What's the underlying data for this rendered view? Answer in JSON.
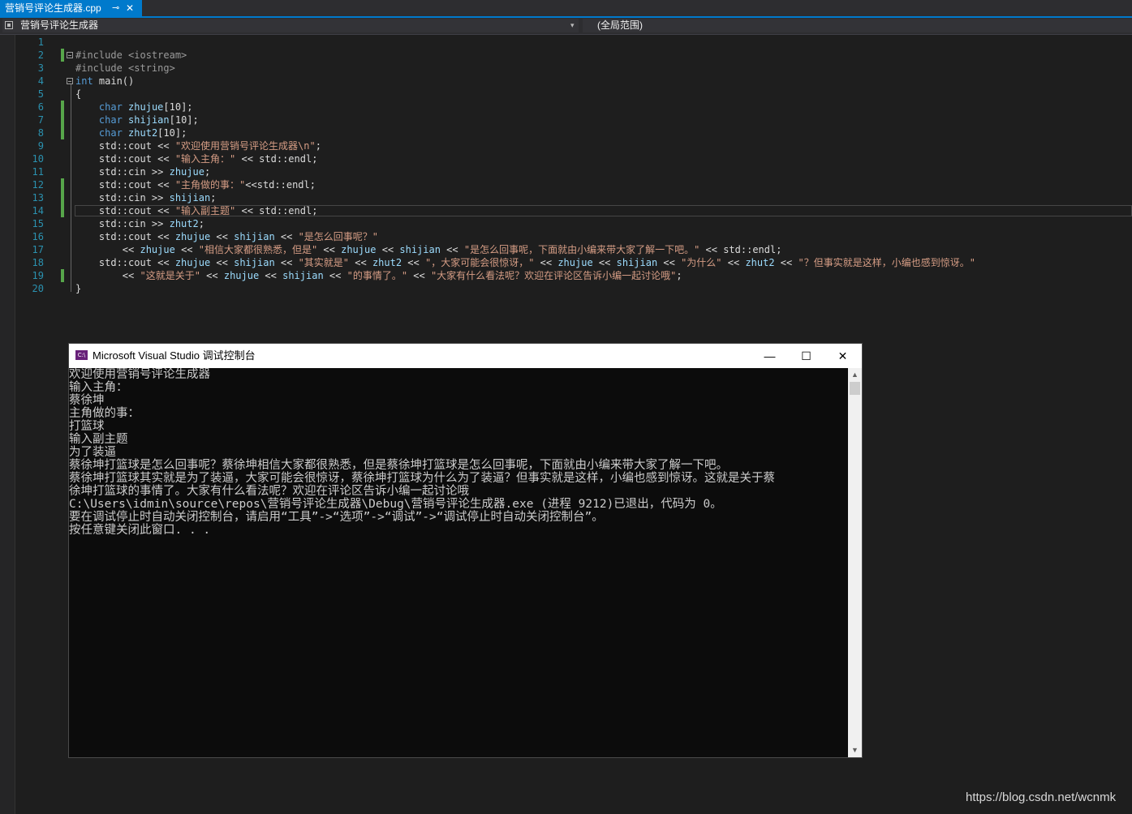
{
  "tab": {
    "title": "营销号评论生成器.cpp",
    "pin": "⊸",
    "close": "✕"
  },
  "nav": {
    "project": "营销号评论生成器",
    "scope": "(全局范围)"
  },
  "editor": {
    "line_numbers": [
      "1",
      "2",
      "3",
      "4",
      "5",
      "6",
      "7",
      "8",
      "9",
      "10",
      "11",
      "12",
      "13",
      "14",
      "15",
      "16",
      "17",
      "18",
      "19",
      "20"
    ],
    "code": [
      "",
      "#include <iostream>",
      "#include <string>",
      "int main()",
      "{",
      "    char zhujue[10];",
      "    char shijian[10];",
      "    char zhut2[10];",
      "    std::cout << \"欢迎使用营销号评论生成器\\n\";",
      "    std::cout << \"输入主角：\" << std::endl;",
      "    std::cin >> zhujue;",
      "    std::cout << \"主角做的事：\"<<std::endl;",
      "    std::cin >> shijian;",
      "    std::cout << \"输入副主题\" << std::endl;",
      "    std::cin >> zhut2;",
      "    std::cout << zhujue << shijian << \"是怎么回事呢？\"",
      "        << zhujue << \"相信大家都很熟悉，但是\" << zhujue << shijian << \"是怎么回事呢，下面就由小编来带大家了解一下吧。\" << std::endl;",
      "    std::cout << zhujue << shijian << \"其实就是\" << zhut2 << \"，大家可能会很惊讶，\" << zhujue << shijian << \"为什么\" << zhut2 << \"？但事实就是这样，小编也感到惊讶。\"",
      "        << \"这就是关于\" << zhujue << shijian << \"的事情了。\" << \"大家有什么看法呢？欢迎在评论区告诉小编一起讨论哦\";",
      "}"
    ]
  },
  "console": {
    "icon": "C:\\",
    "title": "Microsoft Visual Studio 调试控制台",
    "minimize": "—",
    "maximize": "☐",
    "close": "✕",
    "lines": [
      "欢迎使用营销号评论生成器",
      "输入主角：",
      "蔡徐坤",
      "主角做的事：",
      "打篮球",
      "输入副主题",
      "为了装逼",
      "蔡徐坤打篮球是怎么回事呢？蔡徐坤相信大家都很熟悉，但是蔡徐坤打篮球是怎么回事呢，下面就由小编来带大家了解一下吧。",
      "蔡徐坤打篮球其实就是为了装逼，大家可能会很惊讶，蔡徐坤打篮球为什么为了装逼？但事实就是这样，小编也感到惊讶。这就是关于蔡",
      "徐坤打篮球的事情了。大家有什么看法呢？欢迎在评论区告诉小编一起讨论哦",
      "C:\\Users\\idmin\\source\\repos\\营销号评论生成器\\Debug\\营销号评论生成器.exe (进程 9212)已退出，代码为 0。",
      "要在调试停止时自动关闭控制台，请启用“工具”->“选项”->“调试”->“调试停止时自动关闭控制台”。",
      "按任意键关闭此窗口. . ."
    ],
    "scroll_up": "▲",
    "scroll_down": "▼"
  },
  "watermark": "https://blog.csdn.net/wcnmk",
  "colors": {
    "accent": "#007acc",
    "keyword": "#569cd6",
    "string": "#d69d85",
    "variable": "#9cdcfe",
    "line_number": "#2b91af",
    "change_marker": "#57a64a",
    "console_bg": "#0c0c0c"
  }
}
